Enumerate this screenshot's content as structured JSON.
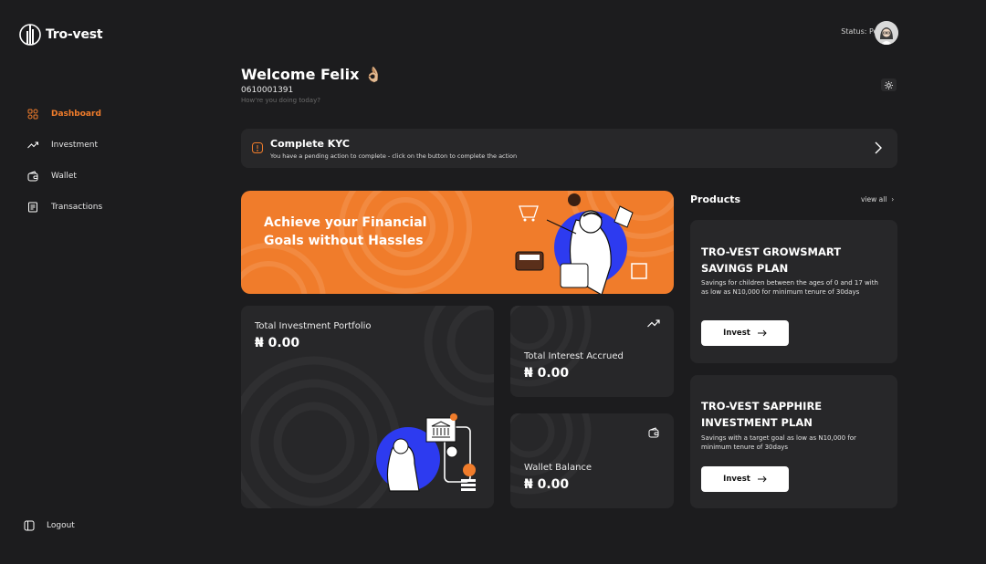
{
  "brand": {
    "name": "Tro-vest"
  },
  "sidebar": {
    "items": [
      {
        "label": "Dashboard",
        "icon": "dashboard-icon",
        "active": true
      },
      {
        "label": "Investment",
        "icon": "trend-up-icon"
      },
      {
        "label": "Wallet",
        "icon": "wallet-icon"
      },
      {
        "label": "Transactions",
        "icon": "receipt-icon"
      }
    ],
    "logout_label": "Logout"
  },
  "header": {
    "status": "Status: Pending"
  },
  "welcome": {
    "title": "Welcome Felix 👌🏼",
    "account_number": "0610001391",
    "greeting": "How're you doing today?"
  },
  "kyc": {
    "title": "Complete KYC",
    "subtitle": "You have a pending action to complete - click on the button to complete the action"
  },
  "banner": {
    "text": "Achieve your Financial Goals without Hassles"
  },
  "cards": {
    "portfolio": {
      "label": "Total Investment Portfolio",
      "value": "₦ 0.00"
    },
    "interest": {
      "label": "Total Interest Accrued",
      "value": "₦ 0.00"
    },
    "wallet": {
      "label": "Wallet Balance",
      "value": "₦ 0.00"
    }
  },
  "products": {
    "title": "Products",
    "view_all": "view all",
    "items": [
      {
        "title": "TRO-VEST GROWSMART SAVINGS PLAN",
        "description": "Savings for children between the ages of 0 and 17 with as low as N10,000 for minimum tenure of 30days",
        "button": "Invest"
      },
      {
        "title": "TRO-VEST SAPPHIRE INVESTMENT PLAN",
        "description": "Savings with a target goal as low as N10,000 for minimum tenure of 30days",
        "button": "Invest"
      }
    ]
  },
  "colors": {
    "accent": "#f07c2b",
    "background": "#1c1c1e",
    "card": "#272729",
    "illustration_blue": "#2d3bf0"
  }
}
